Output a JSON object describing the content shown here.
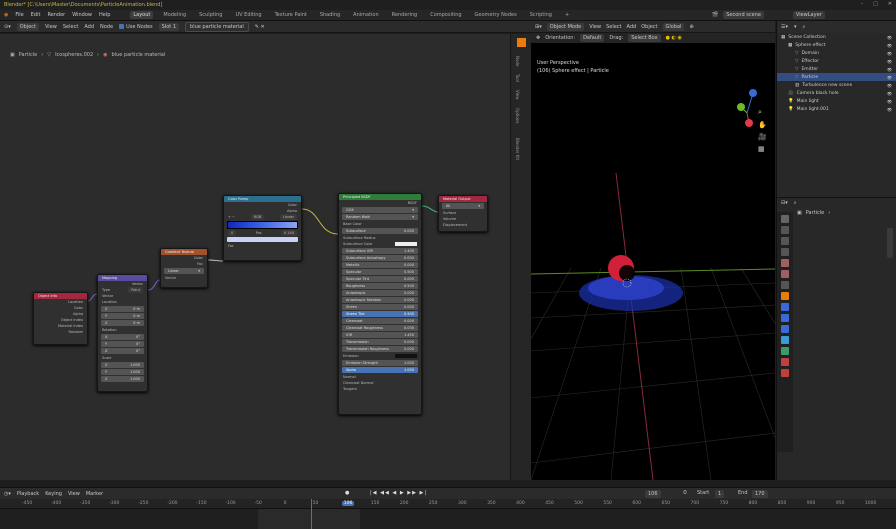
{
  "title_bar": {
    "title": "Blender* [C:\\Users\\Master\\Documents\\ParticleAnimation.blend]",
    "controls": [
      "–",
      "□",
      "✕"
    ]
  },
  "menu": {
    "items": [
      "File",
      "Edit",
      "Render",
      "Window",
      "Help"
    ],
    "workspaces": [
      "Layout",
      "Modeling",
      "Sculpting",
      "UV Editing",
      "Texture Paint",
      "Shading",
      "Animation",
      "Rendering",
      "Compositing",
      "Geometry Nodes",
      "Scripting",
      "+"
    ],
    "active_workspace": "Layout",
    "scene": "Second scene",
    "view_layer": "ViewLayer"
  },
  "node_editor": {
    "header": {
      "editor": "Object",
      "menus": [
        "View",
        "Select",
        "Add",
        "Node"
      ],
      "use_nodes": "Use Nodes",
      "slot": "Slot 1",
      "material": "blue particle material"
    },
    "breadcrumb": [
      "Particle",
      "Icospheres.002",
      "blue particle material"
    ],
    "side_tabs": [
      "Node",
      "Tool",
      "View",
      "Options",
      "Blender Kit"
    ],
    "nodes": {
      "object_info": {
        "title": "Object Info",
        "outputs": [
          "Location",
          "Color",
          "Alpha",
          "Object Index",
          "Material Index",
          "Random"
        ]
      },
      "mapping": {
        "title": "Mapping",
        "output": "Vector",
        "type_label": "Type",
        "type_value": "Point",
        "input": "Vector",
        "location": "Location",
        "rotation": "Rotation",
        "scale": "Scale",
        "xyz": [
          "X",
          "Y",
          "Z"
        ],
        "loc_vals": [
          "0 m",
          "0 m",
          "0 m"
        ],
        "rot_vals": [
          "0°",
          "0°",
          "0°"
        ],
        "scale_vals": [
          "1.000",
          "1.000",
          "1.000"
        ]
      },
      "gradient": {
        "title": "Gradient Texture",
        "outputs": [
          "Color",
          "Fac"
        ],
        "type": "Linear",
        "input": "Vector"
      },
      "color_ramp": {
        "title": "Color Ramp",
        "outputs": [
          "Color",
          "Alpha"
        ],
        "mode": "RGB",
        "interp": "Linear",
        "pos_label": "Pos",
        "pos": "0.140",
        "index": "0",
        "input": "Fac"
      },
      "principled": {
        "title": "Principled BSDF",
        "output": "BSDF",
        "dist": "GGX",
        "sss": "Random Walk",
        "rows": [
          [
            "Base Color",
            ""
          ],
          [
            "Subsurface",
            "0.000"
          ],
          [
            "Subsurface Radius",
            ""
          ],
          [
            "Subsurface Color",
            ""
          ],
          [
            "Subsurface IOR",
            "1.400"
          ],
          [
            "Subsurface Anisotropy",
            "0.000"
          ],
          [
            "Metallic",
            "0.000"
          ],
          [
            "Specular",
            "0.500"
          ],
          [
            "Specular Tint",
            "0.000"
          ],
          [
            "Roughness",
            "0.500"
          ],
          [
            "Anisotropic",
            "0.000"
          ],
          [
            "Anisotropic Rotation",
            "0.000"
          ],
          [
            "Sheen",
            "0.000"
          ],
          [
            "Sheen Tint",
            "0.500"
          ],
          [
            "Clearcoat",
            "0.000"
          ],
          [
            "Clearcoat Roughness",
            "0.030"
          ],
          [
            "IOR",
            "1.450"
          ],
          [
            "Transmission",
            "0.000"
          ],
          [
            "Transmission Roughness",
            "0.000"
          ],
          [
            "Emission",
            ""
          ],
          [
            "Emission Strength",
            "1.000"
          ],
          [
            "Alpha",
            "1.000"
          ]
        ],
        "extra": [
          "Normal",
          "Clearcoat Normal",
          "Tangent"
        ]
      },
      "output": {
        "title": "Material Output",
        "target": "All",
        "inputs": [
          "Surface",
          "Volume",
          "Displacement"
        ]
      }
    }
  },
  "viewport": {
    "header": {
      "mode": "Object Mode",
      "menus": [
        "View",
        "Select",
        "Add",
        "Object"
      ],
      "transform": "Global"
    },
    "subheader": {
      "orientation": "Orientation:",
      "orient_val": "Default",
      "drag": "Drag:",
      "drag_val": "Select Box"
    },
    "info_line1": "User Perspective",
    "info_line2": "(106) Sphere effect | Particle"
  },
  "outliner": {
    "rows": [
      {
        "label": "Scene Collection",
        "indent": 0,
        "sel": false
      },
      {
        "label": "Sphere effect",
        "indent": 1,
        "sel": false
      },
      {
        "label": "Domain",
        "indent": 2,
        "sel": false
      },
      {
        "label": "Effector",
        "indent": 2,
        "sel": false
      },
      {
        "label": "Emitter",
        "indent": 2,
        "sel": false
      },
      {
        "label": "Particle",
        "indent": 2,
        "sel": true
      },
      {
        "label": "Turbulence new scene",
        "indent": 2,
        "sel": false
      },
      {
        "label": "Camera black hole",
        "indent": 1,
        "sel": false
      },
      {
        "label": "Main light",
        "indent": 1,
        "sel": false
      },
      {
        "label": "Main light.001",
        "indent": 1,
        "sel": false
      }
    ]
  },
  "properties": {
    "object": "Particle"
  },
  "timeline": {
    "menus": [
      "Playback",
      "Keying",
      "View",
      "Marker"
    ],
    "current": "106",
    "start_label": "Start",
    "start": "1",
    "end_label": "End",
    "end": "170",
    "ticks": [
      "-450",
      "-400",
      "-350",
      "-300",
      "-250",
      "-200",
      "-150",
      "-100",
      "-50",
      "0",
      "50",
      "106",
      "150",
      "200",
      "250",
      "300",
      "350",
      "400",
      "450",
      "500",
      "550",
      "600",
      "650",
      "700",
      "750",
      "800",
      "850",
      "900",
      "950",
      "1000"
    ]
  },
  "colors": {
    "accent": "#4772b3",
    "title": "#c9b44a",
    "particles_blue": "#2a3fc4",
    "sphere_red": "#d0203a",
    "node_shader": "#2e7d3a",
    "node_texture": "#a0522d",
    "node_converter": "#2a6f8f",
    "node_vector": "#5a4aa0",
    "node_input": "#a3283f",
    "node_output": "#a3283f"
  }
}
